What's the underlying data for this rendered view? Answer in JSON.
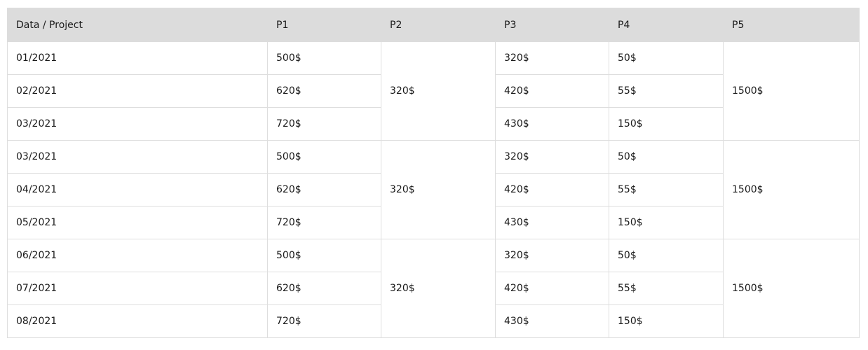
{
  "table": {
    "headers": [
      "Data / Project",
      "P1",
      "P2",
      "P3",
      "P4",
      "P5"
    ],
    "groups": [
      {
        "p2": "320$",
        "p5": "1500$",
        "rows": [
          {
            "date": "01/2021",
            "p1": "500$",
            "p3": "320$",
            "p4": "50$"
          },
          {
            "date": "02/2021",
            "p1": "620$",
            "p3": "420$",
            "p4": "55$"
          },
          {
            "date": "03/2021",
            "p1": "720$",
            "p3": "430$",
            "p4": "150$"
          }
        ]
      },
      {
        "p2": "320$",
        "p5": "1500$",
        "rows": [
          {
            "date": "03/2021",
            "p1": "500$",
            "p3": "320$",
            "p4": "50$"
          },
          {
            "date": "04/2021",
            "p1": "620$",
            "p3": "420$",
            "p4": "55$"
          },
          {
            "date": "05/2021",
            "p1": "720$",
            "p3": "430$",
            "p4": "150$"
          }
        ]
      },
      {
        "p2": "320$",
        "p5": "1500$",
        "rows": [
          {
            "date": "06/2021",
            "p1": "500$",
            "p3": "320$",
            "p4": "50$"
          },
          {
            "date": "07/2021",
            "p1": "620$",
            "p3": "420$",
            "p4": "55$"
          },
          {
            "date": "08/2021",
            "p1": "720$",
            "p3": "430$",
            "p4": "150$"
          }
        ]
      }
    ]
  }
}
